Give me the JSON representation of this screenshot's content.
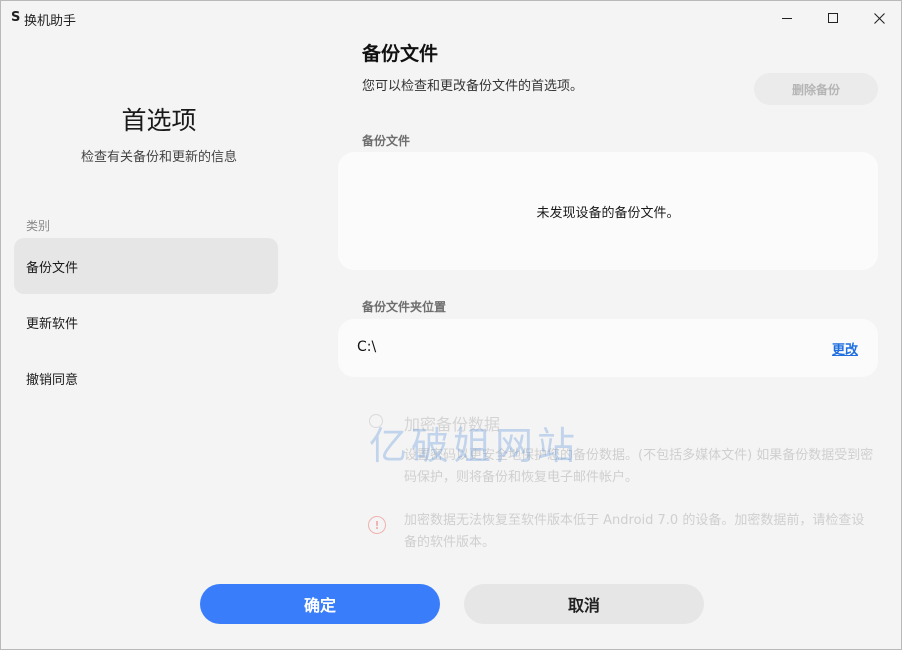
{
  "window": {
    "logo": "S",
    "title": "换机助手",
    "controls": [
      "minimize-icon",
      "maximize-icon",
      "close-icon"
    ]
  },
  "sidebar": {
    "heading": "首选项",
    "subtitle": "检查有关备份和更新的信息",
    "category_label": "类别",
    "items": [
      {
        "label": "备份文件",
        "active": true
      },
      {
        "label": "更新软件",
        "active": false
      },
      {
        "label": "撤销同意",
        "active": false
      }
    ]
  },
  "main": {
    "title": "备份文件",
    "description": "您可以检查和更改备份文件的首选项。",
    "delete_button": "删除备份",
    "backup_section_label": "备份文件",
    "backup_empty_text": "未发现设备的备份文件。",
    "folder_section_label": "备份文件夹位置",
    "folder_path": "C:\\",
    "change_link": "更改",
    "encrypt": {
      "title": "加密备份数据",
      "description": "设置密码以更安全地保护您的备份数据。(不包括多媒体文件) 如果备份数据受到密码保护，则将备份和恢复电子邮件帐户。"
    },
    "warning": {
      "text": "加密数据无法恢复至软件版本低于 Android 7.0 的设备。加密数据前，请检查设备的软件版本。"
    }
  },
  "watermark": "亿破姐网站",
  "footer": {
    "ok_label": "确定",
    "cancel_label": "取消"
  },
  "colors": {
    "accent": "#3a7dfb",
    "link": "#1f6fe0",
    "background": "#f4f4f4",
    "card": "#fbfbfb"
  }
}
